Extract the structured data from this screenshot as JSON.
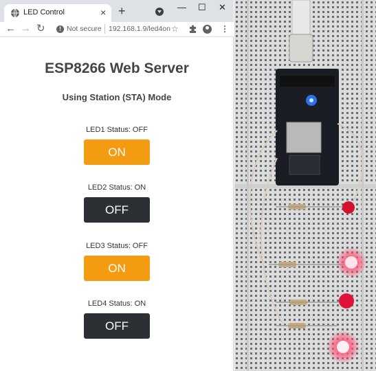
{
  "browser": {
    "tab_title": "LED Control",
    "new_tab_symbol": "+",
    "close_symbol": "×",
    "window_controls": {
      "minimize": "—",
      "maximize": "☐",
      "close": "✕"
    },
    "nav": {
      "back": "←",
      "forward": "→",
      "reload": "↻"
    },
    "security_label": "Not secure",
    "url": "192.168.1.9/led4on",
    "toolbar_icons": [
      "star-icon",
      "puzzle-icon",
      "profile-icon",
      "menu-icon"
    ]
  },
  "page": {
    "title": "ESP8266 Web Server",
    "subtitle": "Using Station (STA) Mode",
    "leds": [
      {
        "status": "LED1 Status: OFF",
        "button": "ON",
        "button_color": "#f39c12"
      },
      {
        "status": "LED2 Status: ON",
        "button": "OFF",
        "button_color": "#2c3034"
      },
      {
        "status": "LED3 Status: OFF",
        "button": "ON",
        "button_color": "#f39c12"
      },
      {
        "status": "LED4 Status: ON",
        "button": "OFF",
        "button_color": "#2c3034"
      }
    ]
  },
  "photo": {
    "subject": "NodeMCU ESP8266 board on a breadboard with four red LEDs"
  }
}
